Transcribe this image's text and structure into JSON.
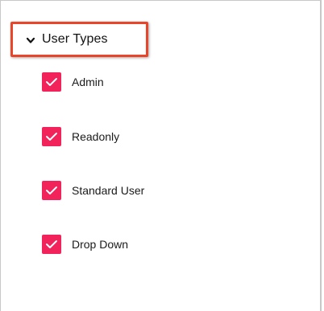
{
  "section": {
    "title": "User Types",
    "expanded": true
  },
  "options": [
    {
      "label": "Admin",
      "checked": true
    },
    {
      "label": "Readonly",
      "checked": true
    },
    {
      "label": "Standard User",
      "checked": true
    },
    {
      "label": "Drop Down",
      "checked": true
    }
  ],
  "colors": {
    "checkbox_fill": "#f2235b",
    "highlight_border": "#e8452a"
  },
  "icons": {
    "expand": "chevron-down-icon",
    "check": "checkmark-icon"
  }
}
